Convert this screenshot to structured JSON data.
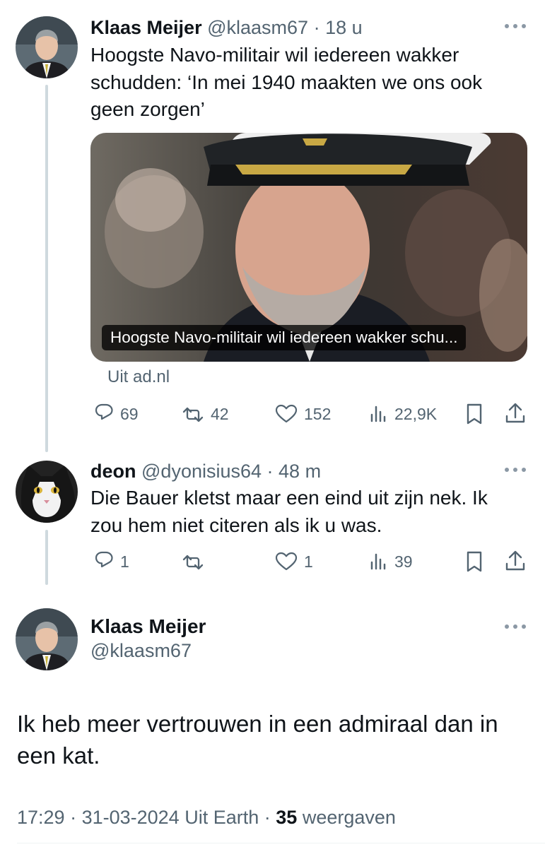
{
  "tweet1": {
    "name": "Klaas Meijer",
    "handle": "@klaasm67",
    "time": "18 u",
    "text_lines": [
      "Hoogste Navo-militair wil iedereen wakker",
      "schudden: ‘In mei 1940 maakten we ons ook",
      "geen zorgen’"
    ],
    "card_caption": "Hoogste Navo-militair wil iedereen wakker schu...",
    "source": "Uit ad.nl",
    "replies": "69",
    "retweets": "42",
    "likes": "152",
    "views": "22,9K"
  },
  "tweet2": {
    "name": "deon",
    "handle": "@dyonisius64",
    "time": "48 m",
    "text_lines": [
      "Die Bauer kletst maar een eind uit zijn nek. Ik",
      "zou hem niet citeren als ik u was."
    ],
    "replies": "1",
    "retweets": "",
    "likes": "1",
    "views": "39"
  },
  "main": {
    "name": "Klaas Meijer",
    "handle": "@klaasm67",
    "text_lines": [
      "Ik heb meer vertrouwen in een admiraal dan in",
      "een kat."
    ],
    "time": "17:29",
    "date": "31-03-2024",
    "source": "Uit Earth",
    "views_count": "35",
    "views_label": "weergaven"
  },
  "icons": {
    "more": "more-horizontal-icon",
    "reply": "reply-icon",
    "retweet": "retweet-icon",
    "like": "heart-icon",
    "views": "views-chart-icon",
    "bookmark": "bookmark-icon",
    "share": "share-icon"
  },
  "colors": {
    "text": "#0f1419",
    "secondary": "#536471",
    "thread_line": "#cfd9de"
  }
}
